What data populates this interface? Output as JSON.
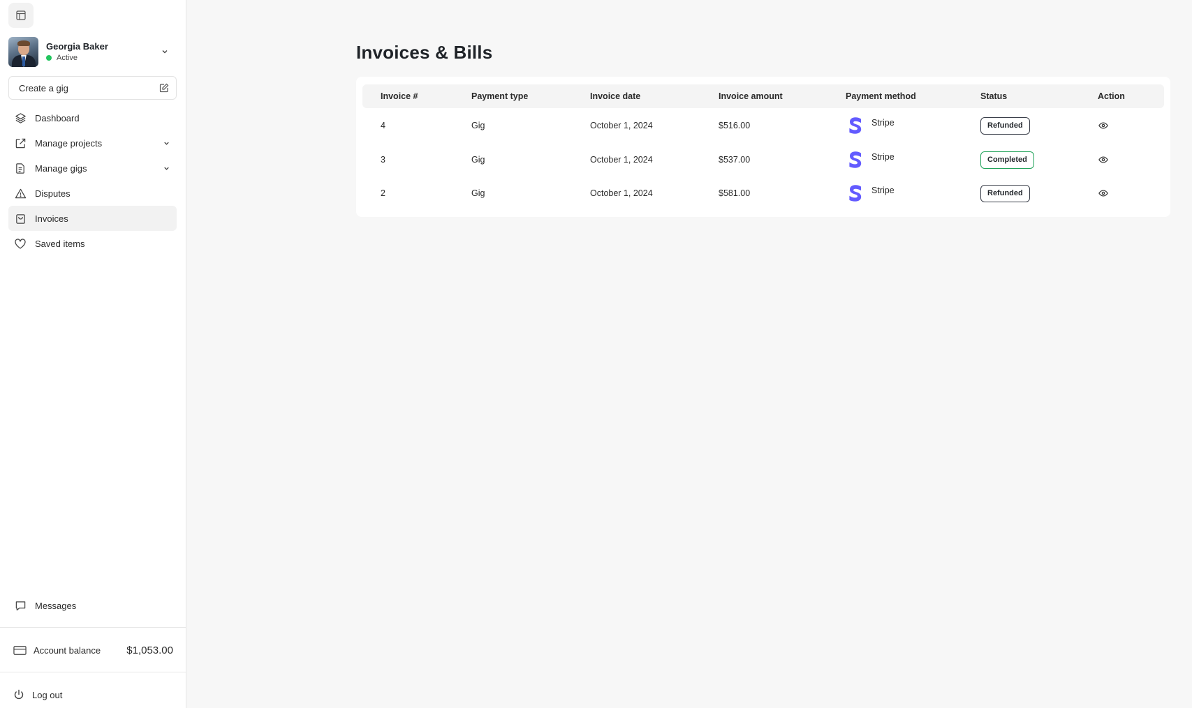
{
  "user": {
    "name": "Georgia Baker",
    "status": "Active",
    "status_color": "#22c55e"
  },
  "sidebar": {
    "create_gig": "Create a gig",
    "items": [
      {
        "label": "Dashboard",
        "icon": "layers-icon",
        "expandable": false
      },
      {
        "label": "Manage projects",
        "icon": "external-link-icon",
        "expandable": true
      },
      {
        "label": "Manage gigs",
        "icon": "document-icon",
        "expandable": true
      },
      {
        "label": "Disputes",
        "icon": "warning-icon",
        "expandable": false
      },
      {
        "label": "Invoices",
        "icon": "shopping-bag-icon",
        "expandable": false,
        "active": true
      },
      {
        "label": "Saved items",
        "icon": "heart-icon",
        "expandable": false
      }
    ],
    "messages": "Messages",
    "account_balance_label": "Account balance",
    "account_balance_value": "$1,053.00",
    "logout": "Log out"
  },
  "main": {
    "title": "Invoices & Bills",
    "columns": [
      "Invoice #",
      "Payment type",
      "Invoice date",
      "Invoice amount",
      "Payment method",
      "Status",
      "Action"
    ],
    "rows": [
      {
        "invoice": "4",
        "type": "Gig",
        "date": "October 1, 2024",
        "amount": "$516.00",
        "method": "Stripe",
        "status": "Refunded",
        "status_color": "#3a3f4a"
      },
      {
        "invoice": "3",
        "type": "Gig",
        "date": "October 1, 2024",
        "amount": "$537.00",
        "method": "Stripe",
        "status": "Completed",
        "status_color": "#22a35a"
      },
      {
        "invoice": "2",
        "type": "Gig",
        "date": "October 1, 2024",
        "amount": "$581.00",
        "method": "Stripe",
        "status": "Refunded",
        "status_color": "#3a3f4a"
      }
    ],
    "stripe_color": "#635bff"
  }
}
